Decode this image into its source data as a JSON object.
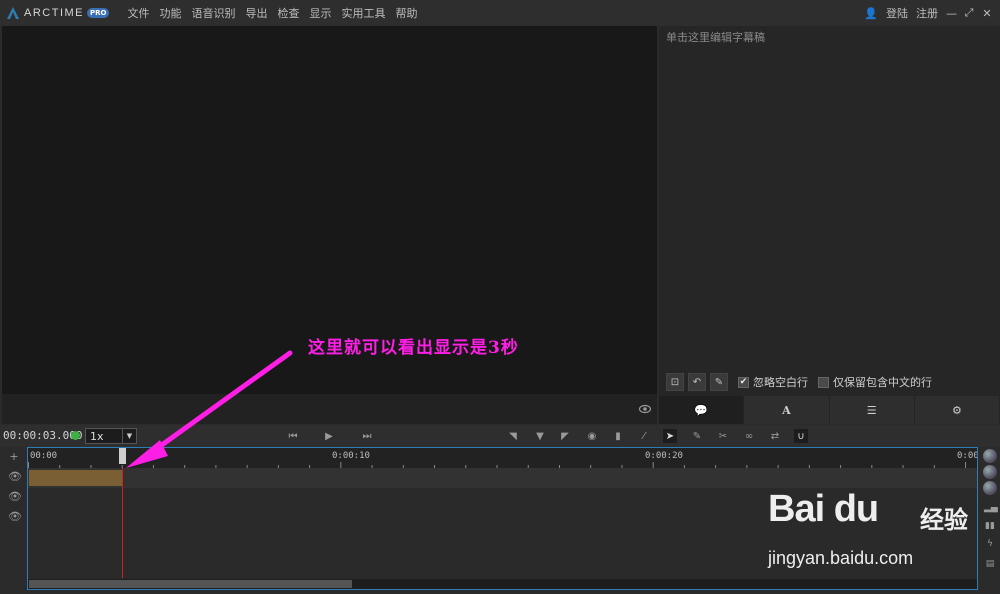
{
  "app": {
    "logo_text": "ARCTIME",
    "logo_badge": "PRO"
  },
  "menu": {
    "items": [
      "文件",
      "功能",
      "语音识别",
      "导出",
      "检查",
      "显示",
      "实用工具",
      "帮助"
    ],
    "login": "登陆",
    "register": "注册"
  },
  "editor": {
    "placeholder": "单击这里编辑字幕稿",
    "ignore_blank_label": "忽略空白行",
    "ignore_blank_checked": true,
    "keep_chinese_label": "仅保留包含中文的行",
    "keep_chinese_checked": false,
    "tabs": [
      {
        "icon": "chat-bubble-icon",
        "label": "💬"
      },
      {
        "icon": "font-icon",
        "label": "A"
      },
      {
        "icon": "list-icon",
        "label": "☰"
      },
      {
        "icon": "gear-icon",
        "label": "⚙"
      }
    ]
  },
  "transport": {
    "timecode": "00:00:03.000",
    "status_color": "#3cb043",
    "speed_value": "1x"
  },
  "timeline": {
    "ruler_labels": [
      "00:00",
      "0:00:10",
      "0:00:20",
      "0:00"
    ],
    "playhead_seconds": 3,
    "clip_start_seconds": 0,
    "clip_end_seconds": 3,
    "scroll_position": 0.34
  },
  "annotation": {
    "text": "这里就可以看出显示是3秒",
    "color": "#ff1ee6"
  },
  "watermark": {
    "logo": "Bai du",
    "cn": "经验",
    "url": "jingyan.baidu.com"
  }
}
